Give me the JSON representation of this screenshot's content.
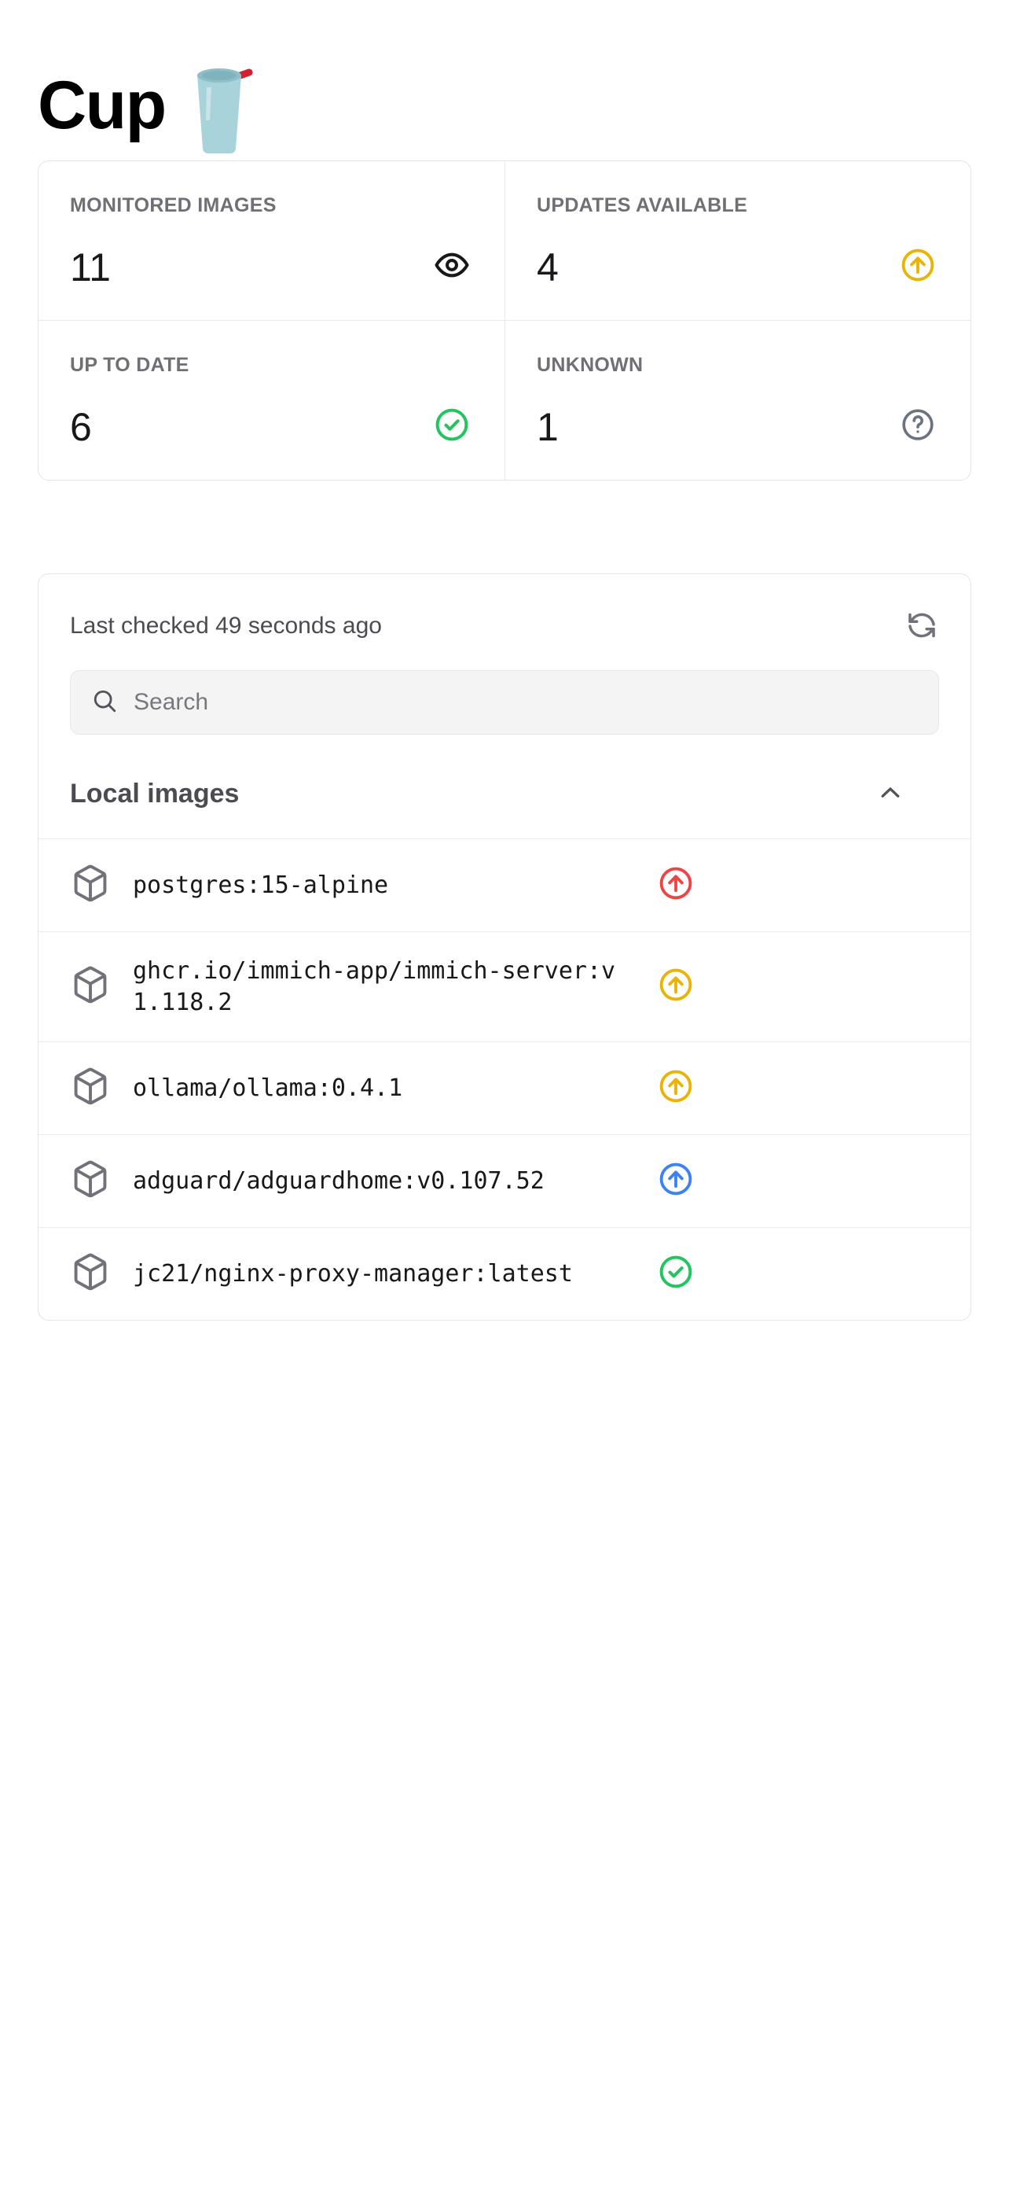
{
  "header": {
    "title": "Cup",
    "logo_icon": "cup-with-straw-icon"
  },
  "stats": [
    {
      "label": "MONITORED IMAGES",
      "value": "11",
      "icon": "eye-icon",
      "icon_color": "#18181b"
    },
    {
      "label": "UPDATES AVAILABLE",
      "value": "4",
      "icon": "arrow-up-circle-icon",
      "icon_color": "#eab308"
    },
    {
      "label": "UP TO DATE",
      "value": "6",
      "icon": "check-circle-icon",
      "icon_color": "#22c55e"
    },
    {
      "label": "UNKNOWN",
      "value": "1",
      "icon": "question-circle-icon",
      "icon_color": "#6b7280"
    }
  ],
  "panel": {
    "last_checked": "Last checked 49 seconds ago",
    "refresh_icon": "refresh-icon",
    "search": {
      "icon": "search-icon",
      "placeholder": "Search",
      "value": ""
    },
    "group": {
      "title": "Local images",
      "collapse_icon": "chevron-up-icon",
      "expanded": true
    },
    "images": [
      {
        "name": "postgres:15-alpine",
        "icon": "box-icon",
        "status": "major-update",
        "status_icon": "arrow-up-circle-icon",
        "status_color": "#ef4444"
      },
      {
        "name": "ghcr.io/immich-app/immich-server:v1.118.2",
        "icon": "box-icon",
        "status": "minor-update",
        "status_icon": "arrow-up-circle-icon",
        "status_color": "#eab308"
      },
      {
        "name": "ollama/ollama:0.4.1",
        "icon": "box-icon",
        "status": "minor-update",
        "status_icon": "arrow-up-circle-icon",
        "status_color": "#eab308"
      },
      {
        "name": "adguard/adguardhome:v0.107.52",
        "icon": "box-icon",
        "status": "patch-update",
        "status_icon": "arrow-up-circle-icon",
        "status_color": "#3b82f6"
      },
      {
        "name": "jc21/nginx-proxy-manager:latest",
        "icon": "box-icon",
        "status": "up-to-date",
        "status_icon": "check-circle-icon",
        "status_color": "#22c55e"
      }
    ]
  }
}
